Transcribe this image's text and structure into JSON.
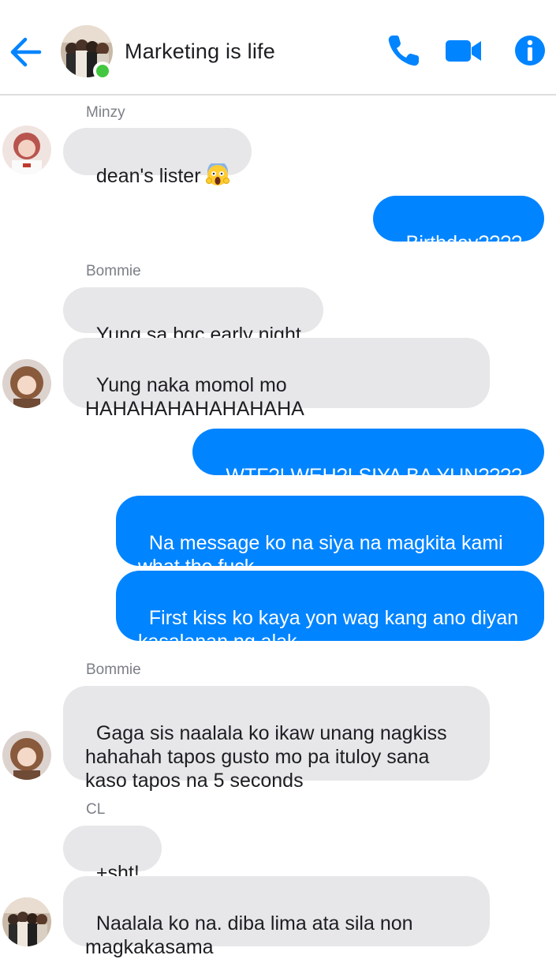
{
  "header": {
    "title": "Marketing is life",
    "online": true,
    "accent_color": "#0084ff",
    "icons": [
      "back-arrow-icon",
      "phone-icon",
      "video-camera-icon",
      "info-icon"
    ]
  },
  "messages": [
    {
      "sender": "Minzy",
      "text": "dean's lister",
      "emoji": "scream-emoji"
    },
    {
      "text": "Birthday????"
    },
    {
      "sender": "Bommie",
      "text": "Yung sa bgc early night"
    },
    {
      "text": "Yung naka momol mo\nHAHAHAHAHAHAHAHA"
    },
    {
      "text": "WTF?! WEH?! SIYA BA YUN????"
    },
    {
      "text": "Na message ko na siya na magkita kami\nwhat the fuck"
    },
    {
      "text": "First kiss ko kaya yon wag kang ano diyan\nkasalanan ng alak"
    },
    {
      "sender": "Bommie",
      "text": "Gaga sis naalala ko ikaw unang nagkiss\nhahahah tapos gusto mo pa ituloy sana\nkaso tapos na 5 seconds"
    },
    {
      "sender": "CL",
      "text": "+sht!"
    },
    {
      "text": "Naalala ko na. diba lima ata sila non\nmagkakasama"
    }
  ],
  "colors": {
    "incoming_bubble": "#e7e7e9",
    "outgoing_bubble": "#0084ff",
    "online_dot": "#44c740"
  }
}
